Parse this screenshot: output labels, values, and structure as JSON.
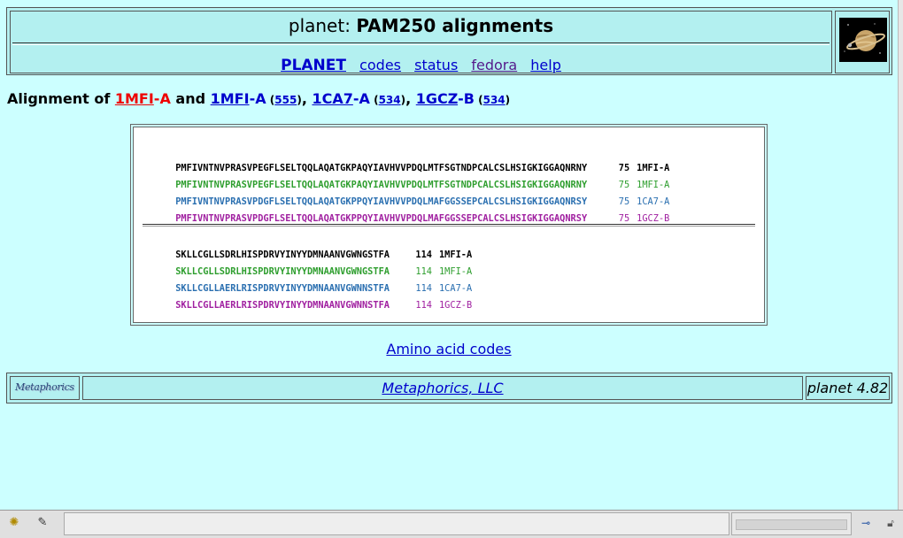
{
  "header": {
    "title_prefix": "planet:",
    "title_main": "PAM250 alignments",
    "nav": [
      {
        "label": "PLANET"
      },
      {
        "label": "codes"
      },
      {
        "label": "status"
      },
      {
        "label": "fedora"
      },
      {
        "label": "help"
      }
    ]
  },
  "heading": {
    "prefix": "Alignment of",
    "ref_id": "1MFI",
    "ref_chain": "-A",
    "and": "and",
    "targets": [
      {
        "id": "1MFI",
        "chain": "-A",
        "score": "555"
      },
      {
        "id": "1CA7",
        "chain": "-A",
        "score": "534"
      },
      {
        "id": "1GCZ",
        "chain": "-B",
        "score": "534"
      }
    ]
  },
  "alignment": {
    "blocks": [
      {
        "rows": [
          {
            "seq": "PMFIVNTNVPRASVPEGFLSELTQQLAQATGKPAQYIAVHVVPDQLMTFSGTNDPCALCSLHSIGKIGGAQNRNY",
            "num": "75",
            "label": "1MFI-A"
          },
          {
            "seq": "PMFIVNTNVPRASVPEGFLSELTQQLAQATGKPAQYIAVHVVPDQLMTFSGTNDPCALCSLHSIGKIGGAQNRNY",
            "num": "75",
            "label": "1MFI-A"
          },
          {
            "seq": "PMFIVNTNVPRASVPDGFLSELTQQLAQATGKPPQYIAVHVVPDQLMAFGGSSEPCALCSLHSIGKIGGAQNRSY",
            "num": "75",
            "label": "1CA7-A"
          },
          {
            "seq": "PMFIVNTNVPRASVPDGFLSELTQQLAQATGKPPQYIAVHVVPDQLMAFGGSSEPCALCSLHSIGKIGGAQNRSY",
            "num": "75",
            "label": "1GCZ-B"
          }
        ]
      },
      {
        "rows": [
          {
            "seq": "SKLLCGLLSDRLHISPDRVYINYYDMNAANVGWNGSTFA",
            "num": "114",
            "label": "1MFI-A"
          },
          {
            "seq": "SKLLCGLLSDRLHISPDRVYINYYDMNAANVGWNGSTFA",
            "num": "114",
            "label": "1MFI-A"
          },
          {
            "seq": "SKLLCGLLAERLRISPDRVYINYYDMNAANVGWNNSTFA",
            "num": "114",
            "label": "1CA7-A"
          },
          {
            "seq": "SKLLCGLLAERLRISPDRVYINYYDMNAANVGWNNSTFA",
            "num": "114",
            "label": "1GCZ-B"
          }
        ]
      }
    ],
    "colors": {
      "ref": "#000000",
      "green": "#2e9e2e",
      "blue": "#2a6fb0",
      "purple": "#a020a0"
    }
  },
  "amino_link": "Amino acid codes",
  "footer": {
    "logo_text": "Metaphorics",
    "link": "Metaphorics, LLC",
    "version": "planet 4.82"
  }
}
